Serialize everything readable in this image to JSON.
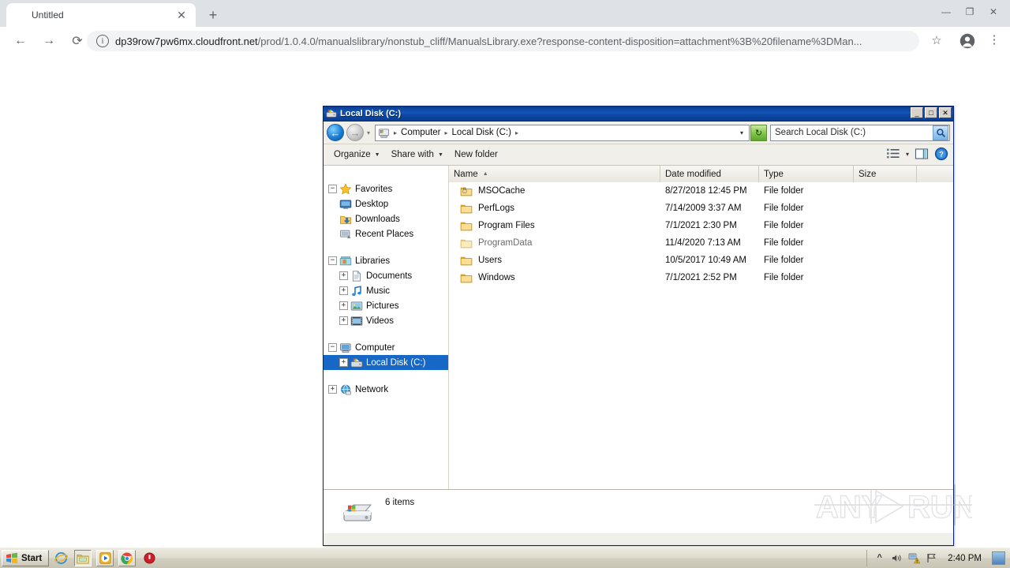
{
  "browser": {
    "tab": {
      "title": "Untitled",
      "close_label": "✕"
    },
    "new_tab_label": "+",
    "window_controls": {
      "minimize": "—",
      "restore": "❐",
      "close": "✕"
    },
    "nav": {
      "back": "←",
      "forward": "→",
      "reload": "⟳"
    },
    "omnibox": {
      "url_host": "dp39row7pw6mx.cloudfront.net",
      "url_path": "/prod/1.0.4.0/manualslibrary/nonstub_cliff/ManualsLibrary.exe?response-content-disposition=attachment%3B%20filename%3DMan...",
      "info_icon": "i",
      "star": "☆"
    },
    "menu": "⋮"
  },
  "explorer": {
    "title": "Local Disk (C:)",
    "title_buttons": {
      "minimize": "_",
      "maximize": "□",
      "close": "✕"
    },
    "address": {
      "back_glyph": "←",
      "forward_glyph": "→",
      "history_glyph": "▾",
      "crumbs": [
        "Computer",
        "Local Disk (C:)"
      ],
      "separator": "▸",
      "caret": "▾",
      "refresh_glyph": "↻"
    },
    "search": {
      "placeholder": "Search Local Disk (C:)",
      "go_icon": "search-icon"
    },
    "commands": [
      {
        "label": "Organize",
        "has_arrow": true
      },
      {
        "label": "Share with",
        "has_arrow": true
      },
      {
        "label": "New folder",
        "has_arrow": false
      }
    ],
    "command_right": {
      "views_icon": "views-list-icon",
      "views_caret": "▾",
      "preview_icon": "preview-pane-icon",
      "help_icon": "help-icon"
    },
    "navpane": [
      {
        "label": "Favorites",
        "expander": "−",
        "icon": "star-icon",
        "indent": false,
        "selected": false
      },
      {
        "label": "Desktop",
        "expander": "",
        "icon": "desktop-icon",
        "indent": true,
        "selected": false
      },
      {
        "label": "Downloads",
        "expander": "",
        "icon": "downloads-icon",
        "indent": true,
        "selected": false
      },
      {
        "label": "Recent Places",
        "expander": "",
        "icon": "recent-places-icon",
        "indent": true,
        "selected": false
      },
      {
        "label": "Libraries",
        "expander": "−",
        "icon": "libraries-icon",
        "indent": false,
        "selected": false
      },
      {
        "label": "Documents",
        "expander": "+",
        "icon": "documents-icon",
        "indent": true,
        "selected": false
      },
      {
        "label": "Music",
        "expander": "+",
        "icon": "music-icon",
        "indent": true,
        "selected": false
      },
      {
        "label": "Pictures",
        "expander": "+",
        "icon": "pictures-icon",
        "indent": true,
        "selected": false
      },
      {
        "label": "Videos",
        "expander": "+",
        "icon": "videos-icon",
        "indent": true,
        "selected": false
      },
      {
        "label": "Computer",
        "expander": "−",
        "icon": "computer-icon",
        "indent": false,
        "selected": false
      },
      {
        "label": "Local Disk (C:)",
        "expander": "+",
        "icon": "harddisk-icon",
        "indent": true,
        "selected": true
      },
      {
        "label": "Network",
        "expander": "+",
        "icon": "network-icon",
        "indent": false,
        "selected": false
      }
    ],
    "columns": [
      {
        "label": "Name",
        "sorted": true,
        "sort_glyph": "▲"
      },
      {
        "label": "Date modified",
        "sorted": false,
        "sort_glyph": ""
      },
      {
        "label": "Type",
        "sorted": false,
        "sort_glyph": ""
      },
      {
        "label": "Size",
        "sorted": false,
        "sort_glyph": ""
      }
    ],
    "rows": [
      {
        "name": "MSOCache",
        "date": "8/27/2018 12:45 PM",
        "type": "File folder",
        "size": "",
        "icon": "locked-folder-icon",
        "hidden": false
      },
      {
        "name": "PerfLogs",
        "date": "7/14/2009 3:37 AM",
        "type": "File folder",
        "size": "",
        "icon": "folder-icon",
        "hidden": false
      },
      {
        "name": "Program Files",
        "date": "7/1/2021 2:30 PM",
        "type": "File folder",
        "size": "",
        "icon": "folder-icon",
        "hidden": false
      },
      {
        "name": "ProgramData",
        "date": "11/4/2020 7:13 AM",
        "type": "File folder",
        "size": "",
        "icon": "folder-icon",
        "hidden": true
      },
      {
        "name": "Users",
        "date": "10/5/2017 10:49 AM",
        "type": "File folder",
        "size": "",
        "icon": "folder-icon",
        "hidden": false
      },
      {
        "name": "Windows",
        "date": "7/1/2021 2:52 PM",
        "type": "File folder",
        "size": "",
        "icon": "folder-icon",
        "hidden": false
      }
    ],
    "status": {
      "text": "6 items",
      "icon": "harddisk-icon"
    }
  },
  "watermark": {
    "left_text": "ANY",
    "right_text": "RUN",
    "glyph": "play-triangle-icon"
  },
  "taskbar": {
    "start_label": "Start",
    "quick_launch": [
      {
        "name": "internet-explorer-icon",
        "active": false
      },
      {
        "name": "windows-explorer-icon",
        "active": true
      },
      {
        "name": "media-player-icon",
        "active": false
      },
      {
        "name": "google-chrome-icon",
        "active": false
      },
      {
        "name": "red-circle-app-icon",
        "active": false
      }
    ],
    "tray": {
      "chevron": "»",
      "volume_icon": "volume-icon",
      "network_icon": "network-warning-icon",
      "flag_icon": "action-center-flag-icon",
      "clock": "2:40 PM",
      "show_desktop": "show-desktop-button"
    }
  },
  "colors": {
    "title_blue": "#0d4aa6",
    "selection_blue": "#1667c6",
    "chrome_tabstrip": "#dee1e6",
    "taskbar": "#d2cec0"
  }
}
